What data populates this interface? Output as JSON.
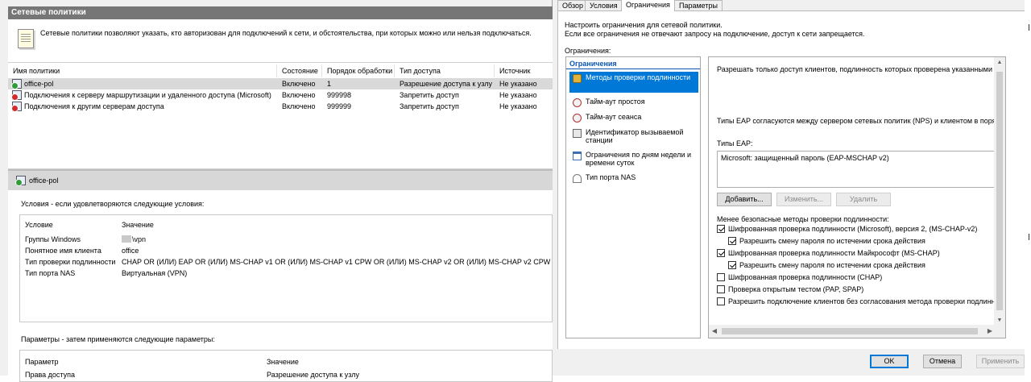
{
  "mmc": {
    "header_title": "Сетевые политики",
    "info_text": "Сетевые политики позволяют указать, кто авторизован для подключений к сети, и обстоятельства, при которых можно или нельзя подключаться.",
    "columns": [
      "Имя политики",
      "Состояние",
      "Порядок обработки",
      "Тип доступа",
      "Источник"
    ],
    "rows": [
      {
        "name": "office-pol",
        "state": "Включено",
        "order": "1",
        "access": "Разрешение доступа к узлу",
        "source": "Не указано",
        "icon": "policy-allow-icon"
      },
      {
        "name": "Подключения к серверу маршрутизации и удаленного доступа (Microsoft)",
        "state": "Включено",
        "order": "999998",
        "access": "Запретить доступ",
        "source": "Не указано",
        "icon": "policy-deny-icon"
      },
      {
        "name": "Подключения к другим серверам доступа",
        "state": "Включено",
        "order": "999999",
        "access": "Запретить доступ",
        "source": "Не указано",
        "icon": "policy-deny-icon"
      }
    ],
    "detail_title": "office-pol",
    "conditions_label": "Условия - если удовлетворяются следующие условия:",
    "conditions_header": {
      "key": "Условие",
      "value": "Значение"
    },
    "conditions": [
      {
        "key": "Группы Windows",
        "value": "\\vpn"
      },
      {
        "key": "Понятное имя клиента",
        "value": "office"
      },
      {
        "key": "Тип проверки подлинности",
        "value": "CHAP OR (ИЛИ) EAP OR (ИЛИ) MS-CHAP v1 OR (ИЛИ) MS-CHAP v1 CPW OR (ИЛИ) MS-CHAP v2 OR (ИЛИ) MS-CHAP v2 CPW"
      },
      {
        "key": "Тип порта NAS",
        "value": "Виртуальная (VPN)"
      }
    ],
    "settings_label": "Параметры - затем применяются следующие параметры:",
    "settings_header": {
      "key": "Параметр",
      "value": "Значение"
    },
    "settings_first": {
      "key": "Права доступа",
      "value": "Разрешение доступа к узлу"
    }
  },
  "dialog": {
    "tabs": [
      {
        "label": "Обзор",
        "active": false
      },
      {
        "label": "Условия",
        "active": false
      },
      {
        "label": "Ограничения",
        "active": true
      },
      {
        "label": "Параметры",
        "active": false
      }
    ],
    "desc_line1": "Настроить ограничения для сетевой политики.",
    "desc_line2": "Если все ограничения не отвечают запросу на подключение, доступ к сети запрещается.",
    "limits_label": "Ограничения:",
    "nav_header": "Ограничения",
    "nav_items": [
      {
        "label": "Методы проверки подлинности",
        "icon": "lock-icon",
        "selected": true
      },
      {
        "label": "Тайм-аут простоя",
        "icon": "idle-timeout-icon",
        "selected": false
      },
      {
        "label": "Тайм-аут сеанса",
        "icon": "session-timeout-icon",
        "selected": false
      },
      {
        "label": "Идентификатор вызываемой станции",
        "icon": "station-id-icon",
        "selected": false
      },
      {
        "label": "Ограничения по дням недели и времени суток",
        "icon": "calendar-icon",
        "selected": false
      },
      {
        "label": "Тип порта NAS",
        "icon": "nas-port-icon",
        "selected": false
      }
    ],
    "content": {
      "line1": "Разрешать только доступ клиентов, подлинность которых проверена указанными мето",
      "line2": "Типы EAP согласуются между сервером сетевых политик (NPS) и клиентом в порядке",
      "eap_label": "Типы EAP:",
      "eap_items": [
        "Microsoft: защищенный пароль (EAP-MSCHAP v2)"
      ],
      "btn_add": "Добавить...",
      "btn_edit": "Изменить...",
      "btn_remove": "Удалить",
      "less_secure_label": "Менее безопасные методы проверки подлинности:",
      "checks": [
        {
          "label": "Шифрованная проверка подлинности (Microsoft), версия 2, (MS-CHAP-v2)",
          "checked": true,
          "indent": false
        },
        {
          "label": "Разрешить смену пароля по истечении срока действия",
          "checked": true,
          "indent": true
        },
        {
          "label": "Шифрованная проверка подлинности Майкрософт (MS-CHAP)",
          "checked": true,
          "indent": false
        },
        {
          "label": "Разрешить смену пароля по истечении срока действия",
          "checked": true,
          "indent": true
        },
        {
          "label": "Шифрованная проверка подлинности (CHAP)",
          "checked": false,
          "indent": false
        },
        {
          "label": "Проверка открытым тестом (PAP, SPAP)",
          "checked": false,
          "indent": false
        },
        {
          "label": "Разрешить подключение клиентов без согласования метода проверки подлинност",
          "checked": false,
          "indent": false
        }
      ]
    },
    "buttons": {
      "ok": "OK",
      "cancel": "Отмена",
      "apply": "Применить"
    }
  }
}
